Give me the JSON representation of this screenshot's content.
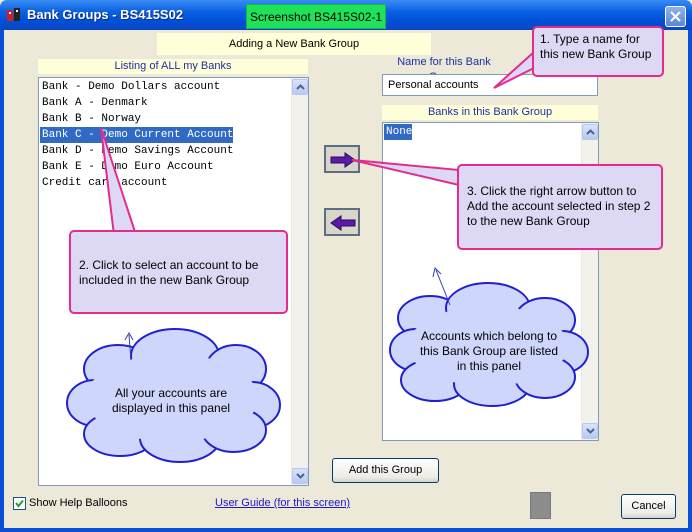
{
  "window": {
    "title": "Bank Groups - BS415S02",
    "badge": "Screenshot BS415S02-1"
  },
  "banner": "Adding a New Bank Group",
  "left_panel": {
    "label": "Listing of ALL my Banks",
    "items": [
      "Bank - Demo Dollars account",
      "Bank A - Denmark",
      "Bank B - Norway",
      "Bank C - Demo Current Account",
      "Bank D - Demo Savings Account",
      "Bank E - Demo Euro Account",
      "Credit card account"
    ],
    "selected": "Bank C - Demo Current Account"
  },
  "name_field": {
    "label": "Name for this Bank Group",
    "value": "Personal accounts"
  },
  "right_panel": {
    "label": "Banks in this Bank Group",
    "items": [
      "None"
    ],
    "selected": "None"
  },
  "balloons": {
    "step1": "1. Type a name for this new Bank Group",
    "step2": "2. Click to select an account to be included in the new Bank Group",
    "step3": "3. Click the right arrow button to Add the account selected in step 2 to the new Bank Group",
    "cloud_left": "All your accounts are displayed in this panel",
    "cloud_right": "Accounts which belong to this Bank Group are listed in this panel"
  },
  "buttons": {
    "add_group": "Add this Group",
    "cancel": "Cancel"
  },
  "footer": {
    "show_help": "Show Help Balloons",
    "show_help_checked": true,
    "user_guide": "User Guide (for this screen)"
  },
  "colors": {
    "title_bar": "#0050d8",
    "badge": "#1ee35a",
    "panel_label_bg": "#ffffd9",
    "selection": "#316ac5",
    "balloon_border": "#e22c8e",
    "balloon_fill": "#ddd9f5",
    "cloud_fill": "#cfd6fc",
    "cloud_border": "#2020d0",
    "arrow_fill": "#5b1aa8"
  },
  "icons": {
    "app": "bank-app-icon",
    "close": "close-x-icon",
    "add_right": "right-arrow-icon",
    "remove_left": "left-arrow-icon"
  }
}
